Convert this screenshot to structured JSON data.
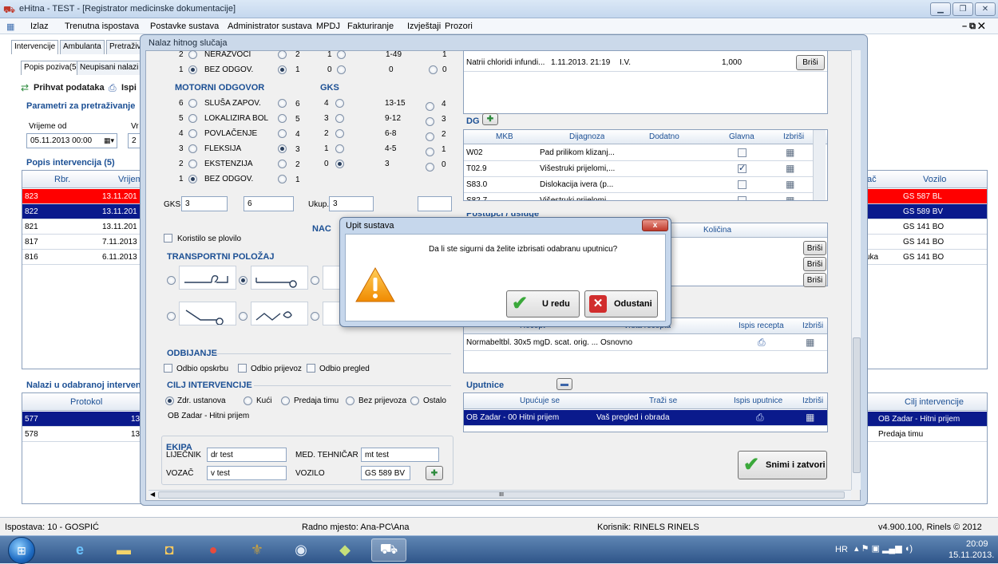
{
  "window": {
    "title": "eHitna - TEST - [Registrator medicinske dokumentacije]"
  },
  "menu": [
    "Izlaz",
    "Trenutna ispostava",
    "Postavke sustava",
    "Administrator sustava",
    "MPDJ",
    "Fakturiranje",
    "Izvještaji",
    "Prozori"
  ],
  "main_tabs": [
    "Intervencije",
    "Ambulanta",
    "Pretraživ"
  ],
  "sub_tabs": [
    "Popis poziva(5)",
    "Neupisani nalazi"
  ],
  "toolbar": {
    "receive": "Prihvat podataka",
    "print": "Ispi"
  },
  "search": {
    "title": "Parametri za pretraživanje",
    "from_label": "Vrijeme od",
    "from_value": "05.11.2013 00:00",
    "to_label": "Vr",
    "to_value": "2"
  },
  "interventions": {
    "title": "Popis intervencija (5)",
    "headers": [
      "Rbr.",
      "Vrijem"
    ],
    "right_headers": [
      "ač",
      "Vozilo"
    ],
    "rows": [
      {
        "rbr": "823",
        "time": "13.11.201",
        "right": "",
        "vozilo": "GS 587 BL"
      },
      {
        "rbr": "822",
        "time": "13.11.201",
        "right": "",
        "vozilo": "GS 589 BV"
      },
      {
        "rbr": "821",
        "time": "13.11.201",
        "right": "",
        "vozilo": "GS 141 BO"
      },
      {
        "rbr": "817",
        "time": "7.11.2013",
        "right": "",
        "vozilo": "GS 141 BO"
      },
      {
        "rbr": "816",
        "time": "6.11.2013",
        "right": "uka",
        "vozilo": "GS 141 BO"
      }
    ]
  },
  "findings": {
    "title": "Nalazi u odabranoj intervenc",
    "headers": [
      "Protokol",
      "Cilj intervencije"
    ],
    "rows": [
      {
        "protokol": "577",
        "mid": "13",
        "cilj": "OB Zadar - Hitni prijem"
      },
      {
        "protokol": "578",
        "mid": "13",
        "cilj": "Predaja timu"
      }
    ]
  },
  "dialog": {
    "title": "Nalaz hitnog slučaja",
    "top_left": {
      "a_num": "2",
      "a_label": "NERAZVOCI",
      "a_score": "2",
      "b_num": "1",
      "b_label": "BEZ ODGOV.",
      "b_score": "1"
    },
    "top_mid": {
      "r1": [
        "1",
        "1-49",
        "1"
      ],
      "r2": [
        "0",
        "0",
        "0"
      ]
    },
    "motor": {
      "title": "MOTORNI ODGOVOR",
      "items": [
        {
          "n": "6",
          "label": "SLUŠA ZAPOV.",
          "s": "6"
        },
        {
          "n": "5",
          "label": "LOKALIZIRA BOL",
          "s": "5"
        },
        {
          "n": "4",
          "label": "POVLAČENJE",
          "s": "4"
        },
        {
          "n": "3",
          "label": "FLEKSIJA",
          "s": "3"
        },
        {
          "n": "2",
          "label": "EKSTENZIJA",
          "s": "2"
        },
        {
          "n": "1",
          "label": "BEZ ODGOV.",
          "s": "1"
        }
      ]
    },
    "gks": {
      "title": "GKS",
      "items": [
        {
          "n": "4",
          "range": "13-15",
          "s": "4"
        },
        {
          "n": "3",
          "range": "9-12",
          "s": "3"
        },
        {
          "n": "2",
          "range": "6-8",
          "s": "2"
        },
        {
          "n": "1",
          "range": "4-5",
          "s": "1"
        },
        {
          "n": "0",
          "range": "3",
          "s": "0"
        }
      ]
    },
    "gks_label": "GKS",
    "gks_val1": "3",
    "gks_val2": "6",
    "ukup_label": "Ukup.",
    "ukup_val": "3",
    "nac_label": "NAC",
    "plovilo": "Koristilo se plovilo",
    "transport_title": "TRANSPORTNI POLOŽAJ",
    "odbijanje": {
      "title": "ODBIJANJE",
      "items": [
        "Odbio opskrbu",
        "Odbio prijevoz",
        "Odbio pregled"
      ]
    },
    "cilj": {
      "title": "CILJ INTERVENCIJE",
      "options": [
        "Zdr. ustanova",
        "Kući",
        "Predaja timu",
        "Bez prijevoza",
        "Ostalo"
      ],
      "value": "OB Zadar - Hitni prijem"
    },
    "ekipa": {
      "title": "EKIPA",
      "lijecnik_label": "LIJEČNIK",
      "lijecnik": "dr test",
      "tehnicar_label": "MED. TEHNIČAR",
      "tehnicar": "mt test",
      "vozac_label": "VOZAČ",
      "vozac": "v test",
      "vozilo_label": "VOZILO",
      "vozilo": "GS 589 BV"
    },
    "therapy_row": {
      "name": "Natrii chloridi infundi...",
      "time": "1.11.2013. 21:19",
      "route": "I.V.",
      "amount": "1,000",
      "delete": "Briši"
    },
    "dg": {
      "title": "DG",
      "headers": [
        "MKB",
        "Dijagnoza",
        "Dodatno",
        "Glavna",
        "Izbriši"
      ],
      "rows": [
        {
          "mkb": "W02",
          "dg": "Pad prilikom klizanj...",
          "main": false
        },
        {
          "mkb": "T02.9",
          "dg": "Višestruki prijelomi,...",
          "main": true
        },
        {
          "mkb": "S83.0",
          "dg": "Dislokacija ivera (p...",
          "main": false
        },
        {
          "mkb": "S82.7",
          "dg": "Višestruki prijelomi...",
          "main": false
        }
      ]
    },
    "postupci": {
      "title": "Postupci / usluge",
      "qty_header": "Količina",
      "delete": "Briši"
    },
    "recept": {
      "headers": [
        "Recept",
        "Vrsta recepta",
        "Ispis recepta",
        "Izbriši"
      ],
      "row": {
        "name": "Normabeltbl. 30x5 mgD. scat. orig. ...",
        "type": "Osnovno"
      }
    },
    "uputnice": {
      "title": "Uputnice",
      "headers": [
        "Upućuje se",
        "Traži se",
        "Ispis uputnice",
        "Izbriši"
      ],
      "row": {
        "to": "OB Zadar - 00 Hitni prijem",
        "req": "Vaš pregled i obrada"
      }
    },
    "save_close": "Snimi i zatvori",
    "scroll_mark": "III"
  },
  "msgbox": {
    "title": "Upit sustava",
    "question": "Da li ste sigurni da želite izbrisati odabranu uputnicu?",
    "ok": "U redu",
    "cancel": "Odustani",
    "close": "x"
  },
  "status": {
    "left": "Ispostava: 10 - GOSPIĆ",
    "mid": "Radno mjesto: Ana-PC\\Ana",
    "user": "Korisnik: RINELS RINELS",
    "version": "v4.900.100, Rinels © 2012"
  },
  "taskbar": {
    "lang": "HR",
    "time": "20:09",
    "date": "15.11.2013."
  },
  "colors": {
    "accent": "#1b4f94",
    "row_red": "#ff0000",
    "row_navy": "#0a1a8c"
  }
}
